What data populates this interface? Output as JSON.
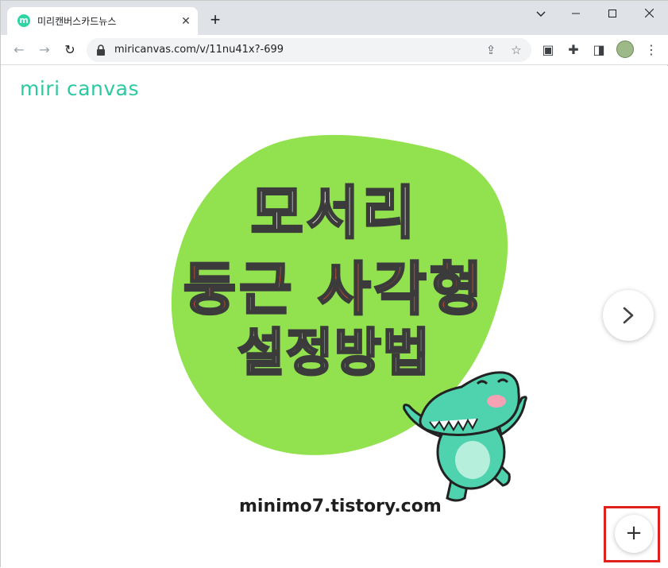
{
  "browser": {
    "tab": {
      "title": "미리캔버스카드뉴스",
      "favicon_letter": "m",
      "close_label": "✕"
    },
    "new_tab_label": "+",
    "window_controls": {
      "dropdown": "⌄",
      "minimize": "—",
      "maximize": "☐",
      "close": "✕"
    },
    "toolbar": {
      "back": "←",
      "forward": "→",
      "reload": "↻",
      "url": "miricanvas.com/v/11nu41x?-699",
      "share": "⇪",
      "bookmark": "☆",
      "media": "▣",
      "extensions": "✚",
      "sidepanel": "◨",
      "menu": "⋮"
    }
  },
  "page": {
    "logo_text": "miri canvas",
    "headline": {
      "line1": "모서리",
      "line2": "둥근 사각형",
      "line3": "설정방법"
    },
    "site_url": "minimo7.tistory.com",
    "next_button": "next",
    "add_button_label": "+"
  },
  "colors": {
    "brand": "#2bc9a0",
    "blob": "#92e14e",
    "headline_accent": "#e8512e",
    "croc_body": "#4ed3ae",
    "highlight_frame": "#e0211b"
  }
}
